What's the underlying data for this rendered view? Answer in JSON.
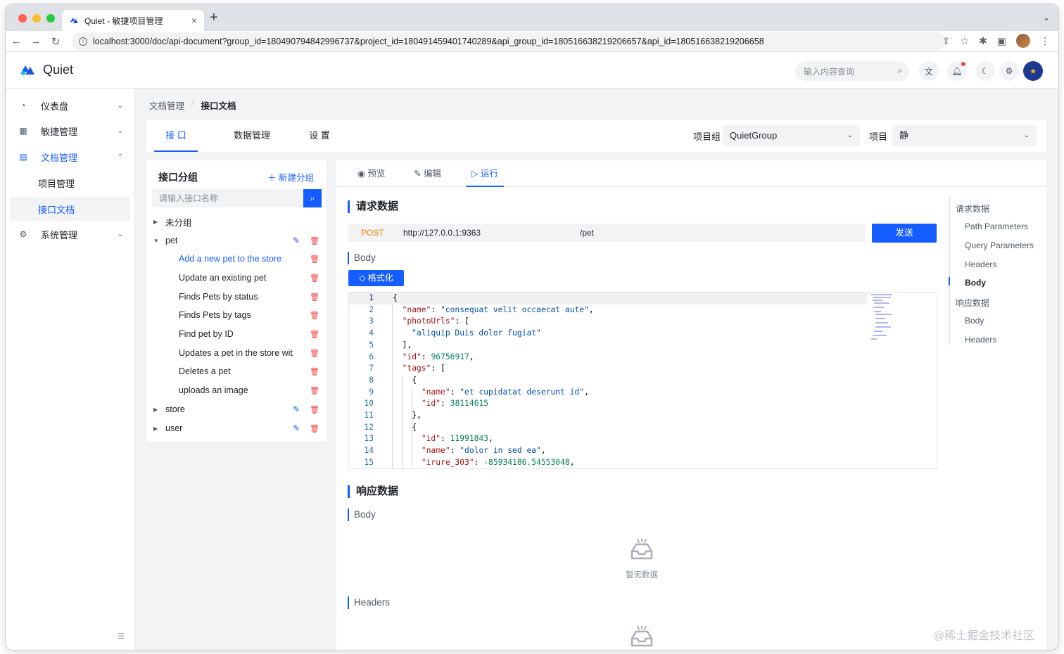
{
  "browser": {
    "tab_title": "Quiet - 敏捷项目管理",
    "tab_close": "×",
    "new_tab": "+",
    "url": "localhost:3000/doc/api-document?group_id=180490794842996737&project_id=180491459401740289&api_group_id=180516638219206657&api_id=180516638219206658"
  },
  "header": {
    "app_name": "Quiet",
    "search_placeholder": "输入内容查询",
    "colors": {
      "brand": "#165dff",
      "danger": "#f53f3f"
    }
  },
  "sidebar": {
    "items": [
      {
        "label": "仪表盘",
        "icon": "dashboard-icon",
        "expanded": false
      },
      {
        "label": "敏捷管理",
        "icon": "grid-icon",
        "expanded": false
      },
      {
        "label": "文档管理",
        "icon": "document-icon",
        "expanded": true,
        "children": [
          {
            "label": "项目管理",
            "selected": false
          },
          {
            "label": "接口文档",
            "selected": true
          }
        ]
      },
      {
        "label": "系统管理",
        "icon": "gear-icon",
        "expanded": false
      }
    ]
  },
  "breadcrumb": {
    "parent": "文档管理",
    "sep": "/",
    "current": "接口文档"
  },
  "top_tabs": [
    {
      "label": "接 口",
      "active": true
    },
    {
      "label": "数据管理",
      "active": false
    },
    {
      "label": "设 置",
      "active": false
    }
  ],
  "selectors": {
    "group_label": "项目组",
    "group_value": "QuietGroup",
    "project_label": "项目",
    "project_value": "静"
  },
  "groups_panel": {
    "title": "接口分组",
    "new_label": "新建分组",
    "search_placeholder": "请输入接口名称",
    "tree": [
      {
        "label": "未分组",
        "type": "group",
        "expanded": false,
        "editable": false,
        "deletable": false
      },
      {
        "label": "pet",
        "type": "group",
        "expanded": true,
        "editable": true,
        "deletable": true
      },
      {
        "label": "Add a new pet to the store",
        "type": "leaf",
        "active": true
      },
      {
        "label": "Update an existing pet",
        "type": "leaf",
        "active": false
      },
      {
        "label": "Finds Pets by status",
        "type": "leaf",
        "active": false
      },
      {
        "label": "Finds Pets by tags",
        "type": "leaf",
        "active": false
      },
      {
        "label": "Find pet by ID",
        "type": "leaf",
        "active": false
      },
      {
        "label": "Updates a pet in the store wit",
        "type": "leaf",
        "active": false
      },
      {
        "label": "Deletes a pet",
        "type": "leaf",
        "active": false
      },
      {
        "label": "uploads an image",
        "type": "leaf",
        "active": false
      },
      {
        "label": "store",
        "type": "group",
        "expanded": false,
        "editable": true,
        "deletable": true
      },
      {
        "label": "user",
        "type": "group",
        "expanded": false,
        "editable": true,
        "deletable": true
      }
    ]
  },
  "main": {
    "subtabs": [
      {
        "label": "预览",
        "icon": "eye-icon",
        "active": false
      },
      {
        "label": "编辑",
        "icon": "pencil-icon",
        "active": false
      },
      {
        "label": "运行",
        "icon": "play-icon",
        "active": true
      }
    ],
    "request_title": "请求数据",
    "method": "POST",
    "base_url": "http://127.0.0.1:9363",
    "path": "/pet",
    "send_label": "发送",
    "body_label": "Body",
    "format_label": "格式化",
    "code_lines": [
      {
        "n": "1",
        "html": "{"
      },
      {
        "n": "2",
        "html": "  <span class=\"k\">\"name\"</span>: <span class=\"s\">\"consequat velit occaecat aute\"</span>,"
      },
      {
        "n": "3",
        "html": "  <span class=\"k\">\"photoUrls\"</span>: ["
      },
      {
        "n": "4",
        "html": "    <span class=\"s\">\"aliquip Duis dolor fugiat\"</span>"
      },
      {
        "n": "5",
        "html": "  ],"
      },
      {
        "n": "6",
        "html": "  <span class=\"k\">\"id\"</span>: <span class=\"n\">96756917</span>,"
      },
      {
        "n": "7",
        "html": "  <span class=\"k\">\"tags\"</span>: ["
      },
      {
        "n": "8",
        "html": "    {"
      },
      {
        "n": "9",
        "html": "      <span class=\"k\">\"name\"</span>: <span class=\"s\">\"et cupidatat deserunt id\"</span>,"
      },
      {
        "n": "10",
        "html": "      <span class=\"k\">\"id\"</span>: <span class=\"n\">38114615</span>"
      },
      {
        "n": "11",
        "html": "    },"
      },
      {
        "n": "12",
        "html": "    {"
      },
      {
        "n": "13",
        "html": "      <span class=\"k\">\"id\"</span>: <span class=\"n\">11991843</span>,"
      },
      {
        "n": "14",
        "html": "      <span class=\"k\">\"name\"</span>: <span class=\"s\">\"dolor in sed ea\"</span>,"
      },
      {
        "n": "15",
        "html": "      <span class=\"k\">\"irure_303\"</span>: <span class=\"n\">-85934186.54553048</span>,"
      }
    ],
    "response_title": "响应数据",
    "response_body_label": "Body",
    "empty_text": "暂无数据",
    "response_headers_label": "Headers"
  },
  "anchors": {
    "items": [
      {
        "label": "请求数据",
        "level": 1,
        "active": false
      },
      {
        "label": "Path Parameters",
        "level": 2,
        "active": false
      },
      {
        "label": "Query Parameters",
        "level": 2,
        "active": false
      },
      {
        "label": "Headers",
        "level": 2,
        "active": false
      },
      {
        "label": "Body",
        "level": 2,
        "active": true
      },
      {
        "label": "响应数据",
        "level": 1,
        "active": false
      },
      {
        "label": "Body",
        "level": 2,
        "active": false
      },
      {
        "label": "Headers",
        "level": 2,
        "active": false
      }
    ]
  },
  "watermark": "@稀土掘金技术社区"
}
